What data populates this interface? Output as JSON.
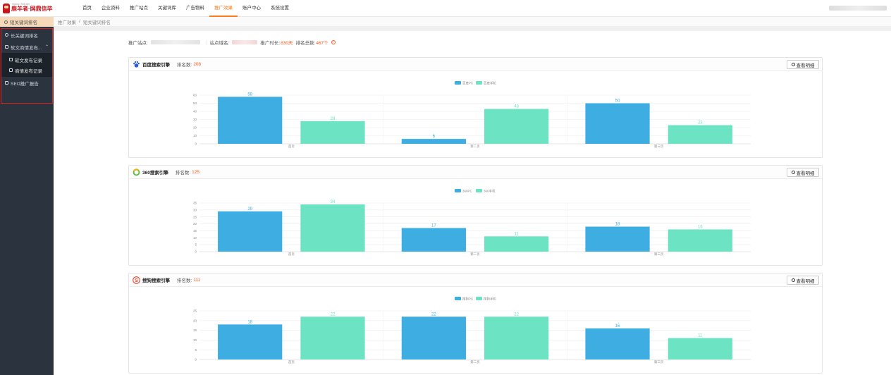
{
  "header": {
    "brand": "鹿羊者·网鼎信毕",
    "brand_sub": "Sheep·WDXB",
    "nav": [
      {
        "label": "首页",
        "active": false
      },
      {
        "label": "企业资料",
        "active": false
      },
      {
        "label": "推广站点",
        "active": false
      },
      {
        "label": "关键词库",
        "active": false
      },
      {
        "label": "广告物料",
        "active": false
      },
      {
        "label": "推广效果",
        "active": true
      },
      {
        "label": "账户中心",
        "active": false
      },
      {
        "label": "系统设置",
        "active": false
      }
    ]
  },
  "sidebar": {
    "head": "短关键词排名",
    "items": [
      {
        "label": "长关键词排名",
        "icon": "eye-icon"
      },
      {
        "label": "软文商情发布...",
        "icon": "document-icon",
        "expanded": true,
        "children": [
          {
            "label": "软文发布记录"
          },
          {
            "label": "商情发布记录"
          }
        ]
      },
      {
        "label": "SEO推广报告",
        "icon": "bar-chart-icon"
      }
    ]
  },
  "breadcrumb": [
    "推广效果",
    "短关键词排名"
  ],
  "info": {
    "site_label": "推广站点:",
    "domain_label": "站点域名:",
    "duration_label": "推广时长:",
    "duration_value": "830天",
    "total_label": "排名总数:",
    "total_value": "467个"
  },
  "detail_button": "查看明细",
  "colors": {
    "pc": "#3eaee2",
    "mobile": "#6ce3c2",
    "accent": "#ff7a1a"
  },
  "panels": [
    {
      "engine": "百度搜索引擎",
      "icon": "baidu-paw-icon",
      "rank_label": "排名数:",
      "rank_value": "208",
      "chart_data": {
        "type": "bar",
        "categories": [
          "首页",
          "第二页",
          "第三页"
        ],
        "ylim": [
          0,
          60
        ],
        "yticks": [
          0,
          10,
          20,
          30,
          40,
          50,
          60
        ],
        "series": [
          {
            "name": "百度PC",
            "values": [
              58,
              6,
              50
            ]
          },
          {
            "name": "百度手机",
            "values": [
              28,
              43,
              23
            ]
          }
        ]
      }
    },
    {
      "engine": "360搜索引擎",
      "icon": "360-ring-icon",
      "rank_label": "排名数:",
      "rank_value": "125",
      "chart_data": {
        "type": "bar",
        "categories": [
          "首页",
          "第二页",
          "第三页"
        ],
        "ylim": [
          0,
          35
        ],
        "yticks": [
          0,
          5,
          10,
          15,
          20,
          25,
          30,
          35
        ],
        "series": [
          {
            "name": "360PC",
            "values": [
              29,
              17,
              18
            ]
          },
          {
            "name": "360手机",
            "values": [
              34,
              11,
              16
            ]
          }
        ]
      }
    },
    {
      "engine": "搜狗搜索引擎",
      "icon": "sogou-s-icon",
      "rank_label": "排名数:",
      "rank_value": "111",
      "chart_data": {
        "type": "bar",
        "categories": [
          "首页",
          "第二页",
          "第三页"
        ],
        "ylim": [
          0,
          25
        ],
        "yticks": [
          0,
          5,
          10,
          15,
          20,
          25
        ],
        "series": [
          {
            "name": "搜狗PC",
            "values": [
              18,
              22,
              16
            ]
          },
          {
            "name": "搜狗手机",
            "values": [
              22,
              22,
              11
            ]
          }
        ]
      }
    }
  ]
}
